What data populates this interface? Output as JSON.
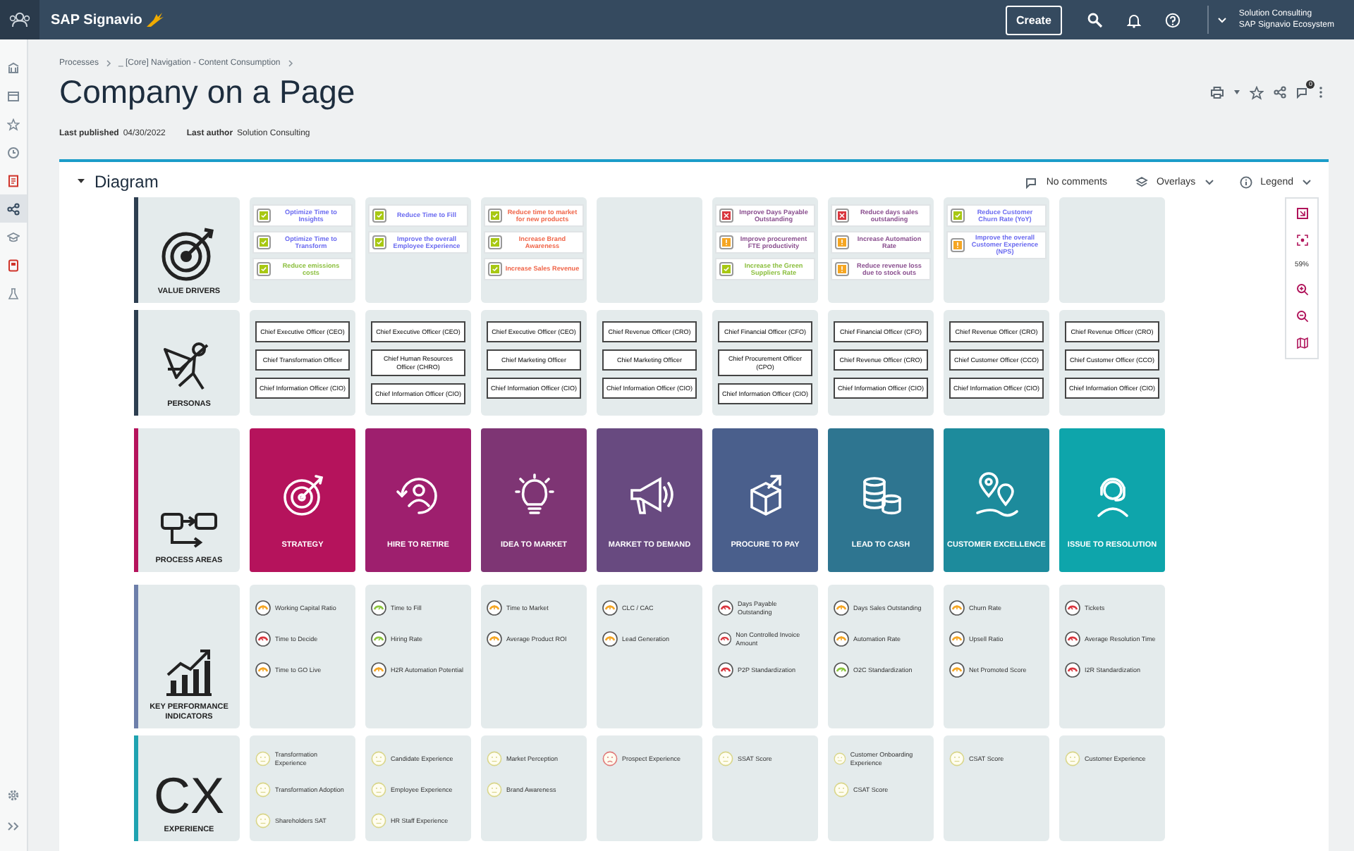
{
  "header": {
    "logo": "SAP Signavio",
    "create_button": "Create",
    "user_name": "Solution Consulting",
    "user_org": "SAP Signavio Ecosystem"
  },
  "sidebar": {
    "items": [
      {
        "selected": false
      },
      {
        "selected": false
      },
      {
        "selected": false
      },
      {
        "selected": false
      },
      {
        "selected": false
      },
      {
        "selected": true
      },
      {
        "selected": false
      },
      {
        "selected": false
      },
      {
        "selected": false
      }
    ]
  },
  "breadcrumb": [
    "Processes",
    "_ [Core] Navigation - Content Consumption"
  ],
  "title": "Company on a Page",
  "meta": [
    {
      "label": "Last published",
      "value": "04/30/2022"
    },
    {
      "label": "Last author",
      "value": "Solution Consulting"
    }
  ],
  "comment_count": "0",
  "diagram": {
    "title": "Diagram",
    "comments": "No comments",
    "overlays": "Overlays",
    "legend": "Legend",
    "zoom": "59%",
    "rows": [
      {
        "kind": "value_drivers",
        "label": "VALUE DRIVERS",
        "color": "#2d3e50",
        "columns": [
          [
            {
              "text": "Optimize Time to Insights",
              "kind": "check",
              "color": "#6b6bf0"
            },
            {
              "text": "Optimize Time to Transform",
              "kind": "check",
              "color": "#6b6bf0"
            },
            {
              "text": "Reduce emissions costs",
              "kind": "check",
              "color": "#8cbf3f"
            }
          ],
          [
            {
              "text": "Reduce Time to Fill",
              "kind": "check",
              "color": "#6b6bf0"
            },
            {
              "text": "Improve the overall Employee Experience",
              "kind": "check",
              "color": "#6b6bf0"
            }
          ],
          [
            {
              "text": "Reduce time to market for new products",
              "kind": "check",
              "color": "#f0664a"
            },
            {
              "text": "Increase Brand Awareness",
              "kind": "check",
              "color": "#f0664a"
            },
            {
              "text": "Increase Sales Revenue",
              "kind": "check",
              "color": "#f0664a"
            }
          ],
          [],
          [
            {
              "text": "Improve Days Payable Outstanding",
              "kind": "cross",
              "color": "#8a4f8f"
            },
            {
              "text": "Improve procurement FTE productivity",
              "kind": "warning",
              "color": "#8a4f8f"
            },
            {
              "text": "Increase the Green Suppliers Rate",
              "kind": "check",
              "color": "#8cbf3f"
            }
          ],
          [
            {
              "text": "Reduce days sales outstanding",
              "kind": "cross",
              "color": "#8a4f8f"
            },
            {
              "text": "Increase Automation Rate",
              "kind": "warning",
              "color": "#8a4f8f"
            },
            {
              "text": "Reduce revenue loss due to stock outs",
              "kind": "warning",
              "color": "#8a4f8f"
            }
          ],
          [
            {
              "text": "Reduce Customer Churn Rate (YoY)",
              "kind": "check",
              "color": "#6b6bf0"
            },
            {
              "text": "Improve the overall Customer Experience (NPS)",
              "kind": "warning",
              "color": "#6b6bf0"
            }
          ],
          []
        ]
      },
      {
        "kind": "personas",
        "label": "PERSONAS",
        "color": "#2d3e50",
        "columns": [
          [
            "Chief Executive Officer (CEO)",
            "Chief Transformation Officer",
            "Chief Information Officer (CIO)"
          ],
          [
            "Chief Executive Officer (CEO)",
            "Chief Human Resources Officer (CHRO)",
            "Chief Information Officer (CIO)"
          ],
          [
            "Chief Executive Officer (CEO)",
            "Chief Marketing Officer",
            "Chief Information Officer (CIO)"
          ],
          [
            "Chief Revenue Officer (CRO)",
            "Chief Marketing Officer",
            "Chief Information Officer (CIO)"
          ],
          [
            "Chief Financial Officer (CFO)",
            "Chief Procurement Officer (CPO)",
            "Chief Information Officer (CIO)"
          ],
          [
            "Chief Financial Officer (CFO)",
            "Chief Revenue Officer (CRO)",
            "Chief Information Officer (CIO)"
          ],
          [
            "Chief Revenue Officer (CRO)",
            "Chief Customer Officer (CCO)",
            "Chief Information Officer (CIO)"
          ],
          [
            "Chief Revenue Officer (CRO)",
            "Chief Customer Officer (CCO)",
            "Chief Information Officer (CIO)"
          ]
        ]
      },
      {
        "kind": "process_areas",
        "label": "PROCESS AREAS",
        "color": "#b5135c",
        "tiles": [
          {
            "label": "STRATEGY",
            "color": "#b5135c"
          },
          {
            "label": "HIRE TO RETIRE",
            "color": "#9e1f6e"
          },
          {
            "label": "IDEA TO MARKET",
            "color": "#7e3574"
          },
          {
            "label": "MARKET TO DEMAND",
            "color": "#684a80"
          },
          {
            "label": "PROCURE TO PAY",
            "color": "#4a5f8c"
          },
          {
            "label": "LEAD TO CASH",
            "color": "#2e7590"
          },
          {
            "label": "CUSTOMER EXCELLENCE",
            "color": "#1d8b9c"
          },
          {
            "label": "ISSUE TO RESOLUTION",
            "color": "#0ea5ab"
          }
        ]
      },
      {
        "kind": "kpis",
        "label": "KEY PERFORMANCE INDICATORS",
        "color": "#6d7faa",
        "columns": [
          [
            {
              "text": "Working Capital Ratio",
              "kind": "warning"
            },
            {
              "text": "Time to Decide",
              "kind": "critical"
            },
            {
              "text": "Time to GO Live",
              "kind": "warning"
            }
          ],
          [
            {
              "text": "Time to Fill",
              "kind": "good"
            },
            {
              "text": "Hiring Rate",
              "kind": "good"
            },
            {
              "text": "H2R Automation Potential",
              "kind": "warning"
            }
          ],
          [
            {
              "text": "Time to Market",
              "kind": "warning"
            },
            {
              "text": "Average Product ROI",
              "kind": "warning"
            }
          ],
          [
            {
              "text": "CLC / CAC",
              "kind": "warning"
            },
            {
              "text": "Lead Generation",
              "kind": "warning"
            }
          ],
          [
            {
              "text": "Days Payable Outstanding",
              "kind": "critical"
            },
            {
              "text": "Non Controlled Invoice Amount",
              "kind": "critical"
            },
            {
              "text": "P2P Standardization",
              "kind": "critical"
            }
          ],
          [
            {
              "text": "Days Sales Outstanding",
              "kind": "warning"
            },
            {
              "text": "Automation Rate",
              "kind": "warning"
            },
            {
              "text": "O2C Standardization",
              "kind": "good"
            }
          ],
          [
            {
              "text": "Churn Rate",
              "kind": "warning"
            },
            {
              "text": "Upsell Ratio",
              "kind": "warning"
            },
            {
              "text": "Net Promoted Score",
              "kind": "warning"
            }
          ],
          [
            {
              "text": "Tickets",
              "kind": "critical"
            },
            {
              "text": "Average Resolution Time",
              "kind": "critical"
            },
            {
              "text": "I2R Standardization",
              "kind": "critical"
            }
          ]
        ]
      },
      {
        "kind": "experience",
        "label": "EXPERIENCE",
        "mark": "CX",
        "color": "#1fa3b0",
        "columns": [
          [
            {
              "text": "Transformation Experience",
              "kind": "neutral"
            },
            {
              "text": "Transformation Adoption",
              "kind": "neutral"
            },
            {
              "text": "Shareholders SAT",
              "kind": "neutral"
            }
          ],
          [
            {
              "text": "Candidate Experience",
              "kind": "neutral"
            },
            {
              "text": "Employee Experience",
              "kind": "neutral"
            },
            {
              "text": "HR Staff Experience",
              "kind": "neutral"
            }
          ],
          [
            {
              "text": "Market Perception",
              "kind": "neutral"
            },
            {
              "text": "Brand Awareness",
              "kind": "neutral"
            }
          ],
          [
            {
              "text": "Prospect Experience",
              "kind": "sad"
            }
          ],
          [
            {
              "text": "SSAT Score",
              "kind": "neutral"
            }
          ],
          [
            {
              "text": "Customer Onboarding Experience",
              "kind": "neutral"
            },
            {
              "text": "CSAT Score",
              "kind": "neutral"
            }
          ],
          [
            {
              "text": "CSAT Score",
              "kind": "neutral"
            }
          ],
          [
            {
              "text": "Customer Experience",
              "kind": "neutral"
            }
          ]
        ]
      }
    ]
  }
}
